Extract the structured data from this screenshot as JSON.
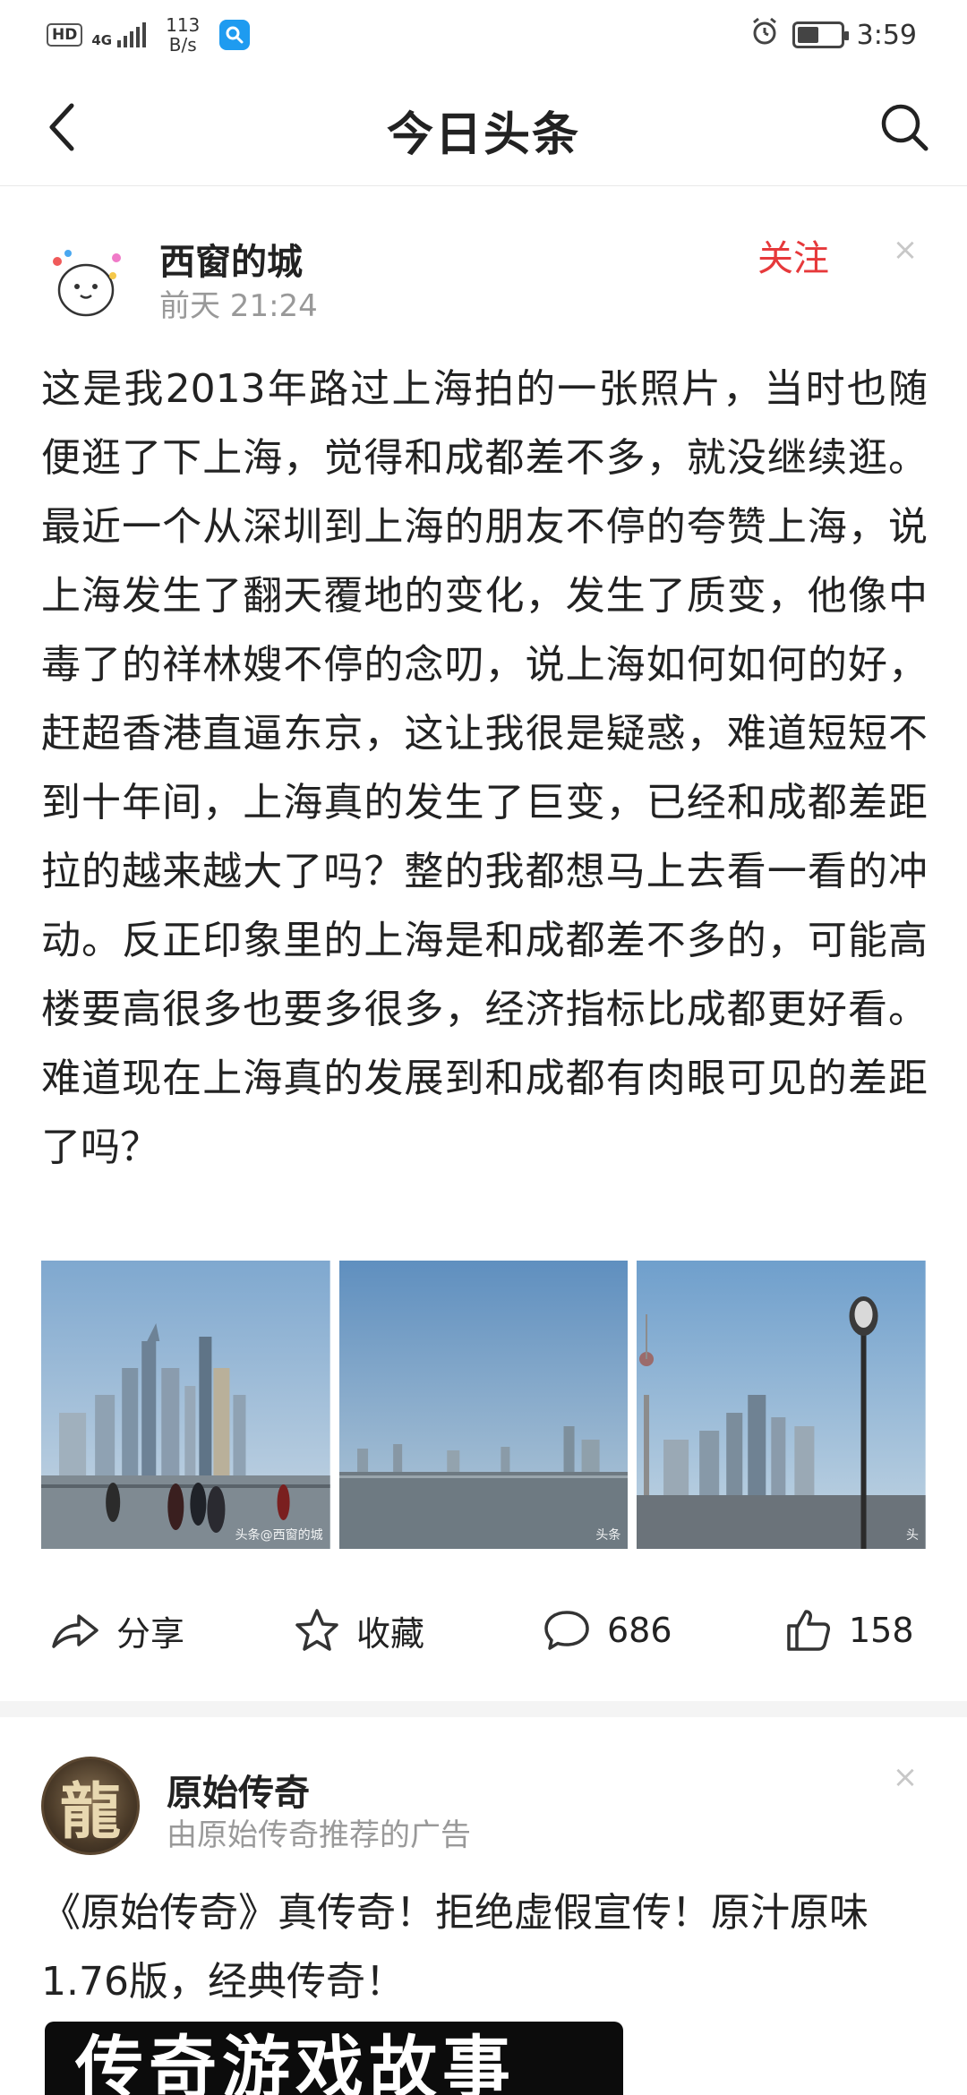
{
  "status_bar": {
    "network_badge": "HD",
    "signal_label": "4G",
    "speed_value": "113",
    "speed_unit": "B/s",
    "time": "3:59",
    "battery_level": 0.5,
    "icons": [
      "hd-icon",
      "signal-icon",
      "app-notification-icon",
      "alarm-icon",
      "battery-icon"
    ]
  },
  "header": {
    "title": "今日头条",
    "back_icon": "chevron-left-icon",
    "search_icon": "search-icon"
  },
  "post": {
    "author": "西窗的城",
    "time": "前天  21:24",
    "follow_label": "关注",
    "close_label": "×",
    "body": "这是我2013年路过上海拍的一张照片，当时也随便逛了下上海，觉得和成都差不多，就没继续逛。最近一个从深圳到上海的朋友不停的夸赞上海，说上海发生了翻天覆地的变化，发生了质变，他像中毒了的祥林嫂不停的念叨，说上海如何如何的好，赶超香港直逼东京，这让我很是疑惑，难道短短不到十年间，上海真的发生了巨变，已经和成都差距拉的越来越大了吗？整的我都想马上去看一看的冲动。反正印象里的上海是和成都差不多的，可能高楼要高很多也要多很多，经济指标比成都更好看。难道现在上海真的发展到和成都有肉眼可见的差距了吗？",
    "images": [
      {
        "watermark": "头条@西窗的城"
      },
      {
        "watermark": "头条"
      },
      {
        "watermark": "头"
      }
    ],
    "actions": {
      "share": "分享",
      "favorite": "收藏",
      "comments": "686",
      "likes": "158"
    }
  },
  "ad": {
    "avatar_char": "龍",
    "name": "原始传奇",
    "subtitle": "由原始传奇推荐的广告",
    "close_label": "×",
    "text": "《原始传奇》真传奇！拒绝虚假宣传！原汁原味1.76版，经典传奇！",
    "banner_text": "传奇游戏故事"
  },
  "colors": {
    "accent_red": "#e6393b",
    "text_primary": "#222222",
    "text_secondary": "#999999"
  }
}
